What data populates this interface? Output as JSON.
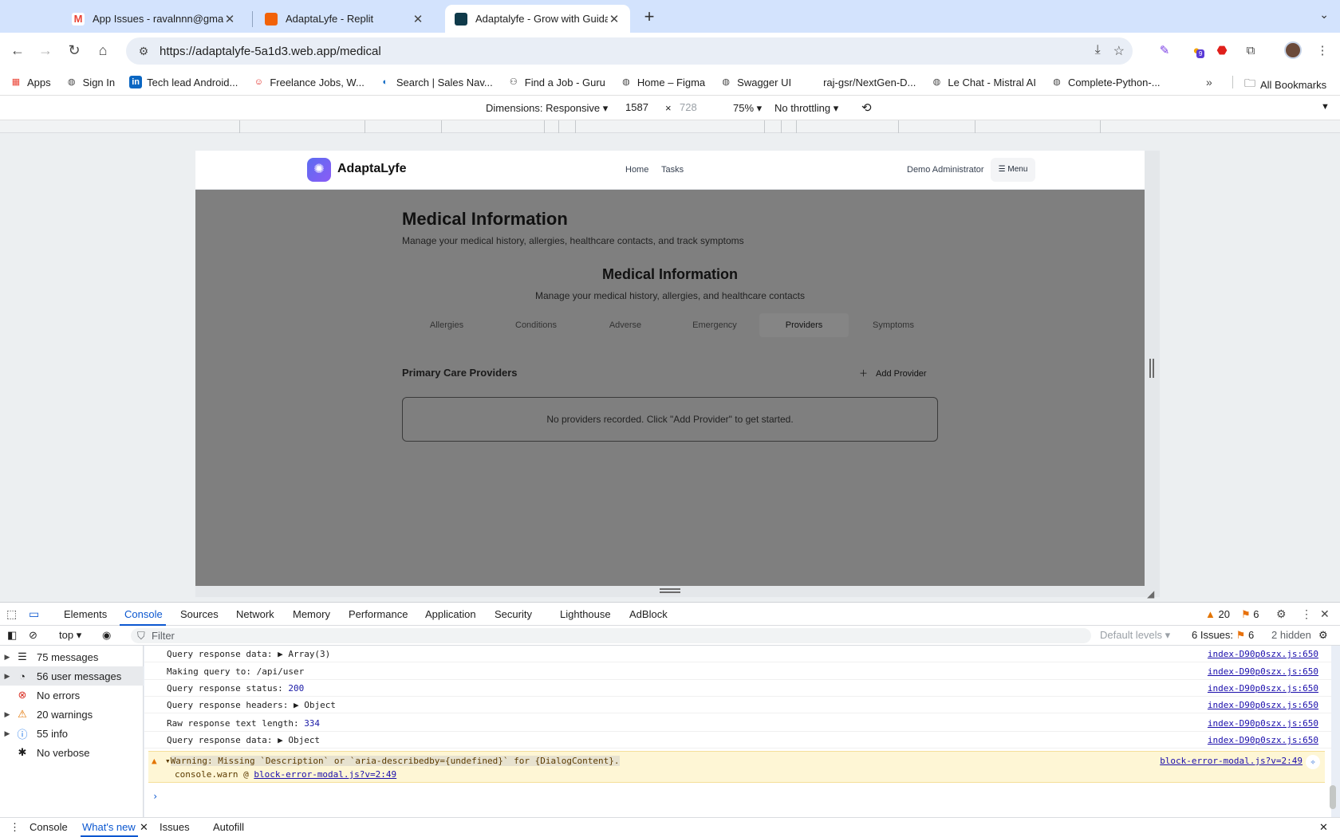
{
  "browser": {
    "tabs": [
      {
        "title": "App Issues - ravalnnn@gmail",
        "favicon_color": "#ea4335",
        "icon": "gmail-icon"
      },
      {
        "title": "AdaptaLyfe - Replit",
        "favicon_color": "#f26207",
        "icon": "replit-icon"
      },
      {
        "title": "Adaptalyfe - Grow with Guida",
        "favicon_color": "#0f3a4a",
        "icon": "adaptalyfe-icon"
      }
    ],
    "url": "https://adaptalyfe-5a1d3.web.app/medical",
    "extension_badge": "9",
    "bookmarks": [
      {
        "label": "Apps",
        "icon": "apps-grid-icon"
      },
      {
        "label": "Sign In",
        "icon": "globe-icon"
      },
      {
        "label": "Tech lead Android...",
        "icon": "linkedin-icon"
      },
      {
        "label": "Freelance Jobs, W...",
        "icon": "freelancer-icon"
      },
      {
        "label": "Search | Sales Nav...",
        "icon": "salesnav-icon"
      },
      {
        "label": "Find a Job - Guru",
        "icon": "guru-icon"
      },
      {
        "label": "Home – Figma",
        "icon": "globe-icon"
      },
      {
        "label": "Swagger UI",
        "icon": "globe-icon"
      },
      {
        "label": "raj-gsr/NextGen-D...",
        "icon": "github-icon"
      },
      {
        "label": "Le Chat - Mistral AI",
        "icon": "globe-icon"
      },
      {
        "label": "Complete-Python-...",
        "icon": "globe-icon"
      }
    ],
    "all_bookmarks": "All Bookmarks"
  },
  "device_toolbar": {
    "dimensions_label": "Dimensions: Responsive",
    "width": "1587",
    "times": "×",
    "height_placeholder": "728",
    "zoom": "75%",
    "throttling": "No throttling"
  },
  "app": {
    "brand": "AdaptaLyfe",
    "nav": [
      "Home",
      "Tasks"
    ],
    "user": "Demo Administrator",
    "menu_label": "Menu",
    "page_title": "Medical Information",
    "page_subtitle": "Manage your medical history, allergies, healthcare contacts, and track symptoms",
    "card_title": "Medical Information",
    "card_subtitle": "Manage your medical history, allergies, and healthcare contacts",
    "tabs": [
      "Allergies",
      "Conditions",
      "Adverse",
      "Emergency",
      "Providers",
      "Symptoms"
    ],
    "active_tab": "Providers",
    "section_title": "Primary Care Providers",
    "add_button": "Add Provider",
    "empty_message": "No providers recorded. Click \"Add Provider\" to get started."
  },
  "devtools": {
    "panels": [
      "Elements",
      "Console",
      "Sources",
      "Network",
      "Memory",
      "Performance",
      "Application",
      "Security",
      "Lighthouse",
      "AdBlock"
    ],
    "active_panel": "Console",
    "warnings_count": "20",
    "issues_count": "6",
    "context": "top",
    "filter_placeholder": "Filter",
    "levels": "Default levels",
    "issues_label": "6 Issues:",
    "issues_num": "6",
    "hidden": "2 hidden",
    "sidebar": [
      {
        "label": "75 messages",
        "icon": "list-icon"
      },
      {
        "label": "56 user messages",
        "icon": "user-icon"
      },
      {
        "label": "No errors",
        "icon": "error-icon"
      },
      {
        "label": "20 warnings",
        "icon": "warning-icon"
      },
      {
        "label": "55 info",
        "icon": "info-icon"
      },
      {
        "label": "No verbose",
        "icon": "bug-icon"
      }
    ],
    "logs": [
      {
        "text": "Query response data: ",
        "expand": "▶ Array(3)",
        "num": "",
        "source": "index-D90p0szx.js:650"
      },
      {
        "text": "Making query to: /api/user",
        "expand": "",
        "num": "",
        "source": "index-D90p0szx.js:650"
      },
      {
        "text": "Query response status: ",
        "expand": "",
        "num": "200",
        "source": "index-D90p0szx.js:650"
      },
      {
        "text": "Query response headers: ",
        "expand": "▶ Object",
        "num": "",
        "source": "index-D90p0szx.js:650"
      },
      {
        "text": "Raw response text length: ",
        "expand": "",
        "num": "334",
        "source": "index-D90p0szx.js:650"
      },
      {
        "text": "Query response data: ",
        "expand": "▶ Object",
        "num": "",
        "source": "index-D90p0szx.js:650"
      }
    ],
    "warning": {
      "line1": "Warning: Missing `Description` or `aria-describedby={undefined}` for {DialogContent}.",
      "line2_prefix": "console.warn @ ",
      "line2_link": "block-error-modal.js?v=2:49",
      "source": "block-error-modal.js?v=2:49"
    },
    "drawer_tabs": [
      "Console",
      "What's new",
      "Issues",
      "Autofill"
    ],
    "drawer_active": "What's new"
  }
}
